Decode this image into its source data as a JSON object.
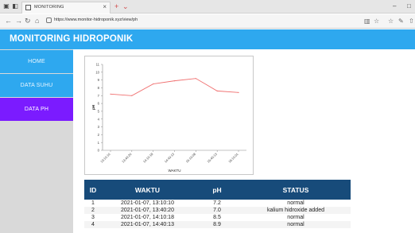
{
  "browser": {
    "tab_title": "MONITORING",
    "url": "https://www.monitor-hidroponik.xyz/view/ph",
    "new_tab_glyph": "+",
    "tab_dropdown_glyph": "⌄",
    "tab_close_glyph": "×"
  },
  "header": {
    "title": "MONITORING HIDROPONIK",
    "color": "#2ea8ef"
  },
  "sidebar": {
    "items": [
      {
        "label": "HOME",
        "active": false
      },
      {
        "label": "DATA SUHU",
        "active": false
      },
      {
        "label": "DATA PH",
        "active": true
      }
    ],
    "active_color": "#7b1bff"
  },
  "chart_data": {
    "type": "line",
    "x": [
      "13:10:10",
      "13:40:20",
      "14:10:18",
      "14:40:13",
      "15:10:08",
      "15:40:13",
      "16:10:01"
    ],
    "series": [
      {
        "values": [
          7.2,
          7.0,
          8.5,
          8.9,
          9.2,
          7.6,
          7.4
        ],
        "color": "#f07070"
      }
    ],
    "ylim": [
      0,
      11
    ],
    "yticks": [
      0,
      1,
      2,
      3,
      4,
      5,
      6,
      7,
      8,
      9,
      10,
      11
    ],
    "xlabel": "WAKTU",
    "ylabel": "pH",
    "grid": false
  },
  "table": {
    "headers": [
      "ID",
      "WAKTU",
      "pH",
      "STATUS"
    ],
    "rows": [
      [
        "1",
        "2021-01-07, 13:10:10",
        "7.2",
        "normal"
      ],
      [
        "2",
        "2021-01-07, 13:40:20",
        "7.0",
        "kalium hidroxide added"
      ],
      [
        "3",
        "2021-01-07, 14:10:18",
        "8.5",
        "normal"
      ],
      [
        "4",
        "2021-01-07, 14:40:13",
        "8.9",
        "normal"
      ]
    ],
    "header_color": "#174b7a"
  }
}
